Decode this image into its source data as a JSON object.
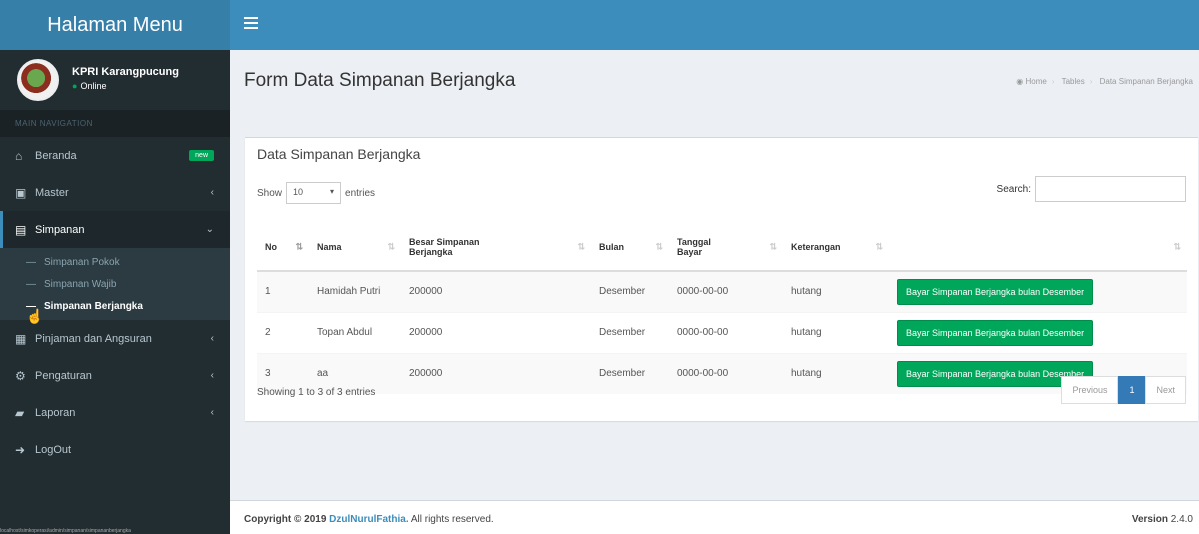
{
  "header": {
    "logo": "Halaman Menu",
    "toggle_icon": "hamburger-icon"
  },
  "sidebar": {
    "user_name": "KPRI Karangpucung",
    "user_status": "Online",
    "nav_header": "MAIN NAVIGATION",
    "new_badge": "new",
    "items": [
      {
        "label": "Beranda",
        "icon": "home-icon"
      },
      {
        "label": "Master",
        "icon": "laptop-icon"
      },
      {
        "label": "Simpanan",
        "icon": "table-icon"
      },
      {
        "label": "Pinjaman dan Angsuran",
        "icon": "table-icon"
      },
      {
        "label": "Pengaturan",
        "icon": "cogs-icon"
      },
      {
        "label": "Laporan",
        "icon": "book-icon"
      },
      {
        "label": "LogOut",
        "icon": "sign-out-icon"
      }
    ],
    "submenu": [
      {
        "label": "Simpanan Pokok"
      },
      {
        "label": "Simpanan Wajib"
      },
      {
        "label": "Simpanan Berjangka"
      }
    ]
  },
  "content": {
    "page_title": "Form Data Simpanan Berjangka",
    "breadcrumb": [
      "Home",
      "Tables",
      "Data Simpanan Berjangka"
    ]
  },
  "box": {
    "title": "Data Simpanan Berjangka",
    "show_label": "Show",
    "entries_value": "10",
    "entries_label": "entries",
    "search_label": "Search:",
    "columns": [
      "No",
      "Nama",
      "Besar Simpanan Berjangka",
      "Bulan",
      "Tanggal Bayar",
      "Keterangan",
      ""
    ],
    "rows": [
      {
        "no": "1",
        "nama": "Hamidah Putri",
        "besar": "200000",
        "bulan": "Desember",
        "tanggal": "0000-00-00",
        "ket": "hutang",
        "action": "Bayar Simpanan Berjangka bulan Desember"
      },
      {
        "no": "2",
        "nama": "Topan Abdul",
        "besar": "200000",
        "bulan": "Desember",
        "tanggal": "0000-00-00",
        "ket": "hutang",
        "action": "Bayar Simpanan Berjangka bulan Desember"
      },
      {
        "no": "3",
        "nama": "aa",
        "besar": "200000",
        "bulan": "Desember",
        "tanggal": "0000-00-00",
        "ket": "hutang",
        "action": "Bayar Simpanan Berjangka bulan Desember"
      }
    ],
    "info": "Showing 1 to 3 of 3 entries",
    "pagination": {
      "previous": "Previous",
      "current": "1",
      "next": "Next"
    }
  },
  "footer": {
    "copyright": "Copyright © 2019",
    "author": "DzulNurulFathia.",
    "rights": "All rights reserved.",
    "version_label": "Version",
    "version_value": "2.4.0"
  },
  "status_url": "localhost/simkoperasi/admin/simpanan/simpananberjangka"
}
